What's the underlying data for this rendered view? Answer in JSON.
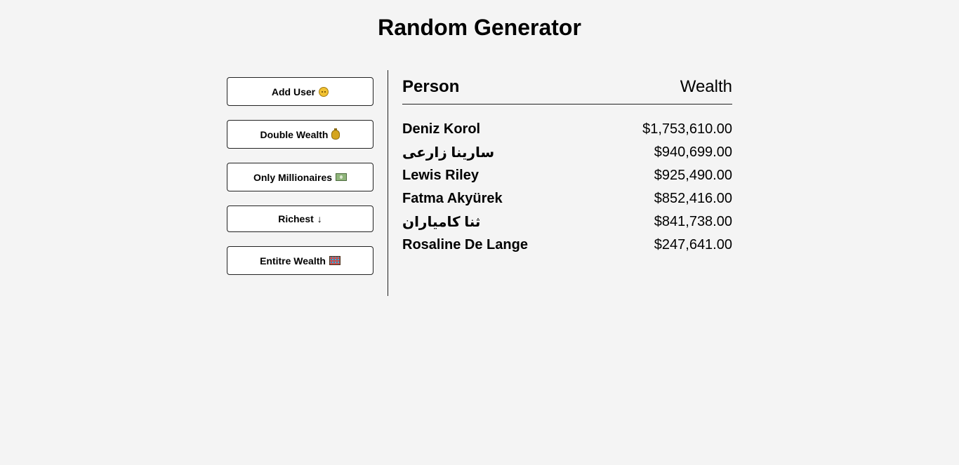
{
  "title": "Random Generator",
  "buttons": {
    "add_user": "Add User",
    "double_wealth": "Double Wealth",
    "only_millionaires": "Only Millionaires",
    "richest": "Richest",
    "richest_arrow": "↓",
    "entire_wealth": "Entitre Wealth"
  },
  "icons": {
    "add_user": "face-icon",
    "double_wealth": "money-bag-icon",
    "only_millionaires": "dollar-bill-icon",
    "entire_wealth": "abacus-icon"
  },
  "table": {
    "header_person": "Person",
    "header_wealth": "Wealth",
    "rows": [
      {
        "name": "Deniz Korol",
        "wealth": "$1,753,610.00"
      },
      {
        "name": "سارينا زارعی",
        "wealth": "$940,699.00"
      },
      {
        "name": "Lewis Riley",
        "wealth": "$925,490.00"
      },
      {
        "name": "Fatma Akyürek",
        "wealth": "$852,416.00"
      },
      {
        "name": "ثنا کامیاران",
        "wealth": "$841,738.00"
      },
      {
        "name": "Rosaline De Lange",
        "wealth": "$247,641.00"
      }
    ]
  }
}
